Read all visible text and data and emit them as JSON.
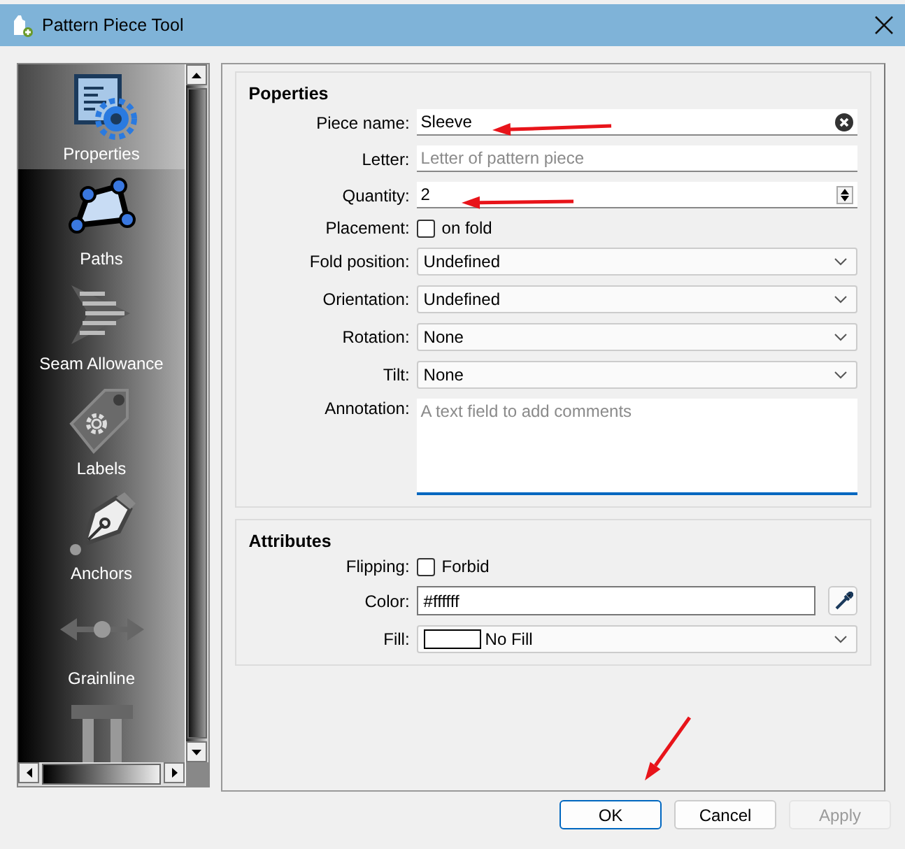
{
  "window": {
    "title": "Pattern Piece Tool"
  },
  "sidebar": {
    "items": [
      {
        "label": "Properties",
        "kind": "properties",
        "selected": true
      },
      {
        "label": "Paths",
        "kind": "paths",
        "selected": false
      },
      {
        "label": "Seam Allowance",
        "kind": "seam",
        "selected": false
      },
      {
        "label": "Labels",
        "kind": "labels",
        "selected": false
      },
      {
        "label": "Anchors",
        "kind": "anchors",
        "selected": false
      },
      {
        "label": "Grainline",
        "kind": "grainline",
        "selected": false
      },
      {
        "kind": "pillar",
        "selected": false
      }
    ]
  },
  "groups": [
    {
      "title": "Poperties",
      "fields": [
        {
          "label": "Piece name:",
          "kind": "text",
          "value": "Sleeve",
          "clearable": true
        },
        {
          "label": "Letter:",
          "kind": "text",
          "placeholder": "Letter of pattern piece"
        },
        {
          "label": "Quantity:",
          "kind": "spin",
          "value": "2"
        },
        {
          "label": "Placement:",
          "kind": "checkbox",
          "text": "on fold",
          "checked": false
        },
        {
          "label": "Fold position:",
          "kind": "combo",
          "value": "Undefined"
        },
        {
          "label": "Orientation:",
          "kind": "combo",
          "value": "Undefined"
        },
        {
          "label": "Rotation:",
          "kind": "combo",
          "value": "None"
        },
        {
          "label": "Tilt:",
          "kind": "combo",
          "value": "None"
        },
        {
          "label": "Annotation:",
          "kind": "textarea",
          "placeholder": "A text field to add comments",
          "focused": true
        }
      ]
    },
    {
      "title": "Attributes",
      "fields": [
        {
          "label": "Flipping:",
          "kind": "checkbox",
          "text": "Forbid",
          "checked": false
        },
        {
          "label": "Color:",
          "kind": "color",
          "value": "#ffffff"
        },
        {
          "label": "Fill:",
          "kind": "fill",
          "value": "No Fill"
        }
      ]
    }
  ],
  "buttons": [
    {
      "label": "OK",
      "default": true,
      "disabled": false
    },
    {
      "label": "Cancel",
      "default": false,
      "disabled": false
    },
    {
      "label": "Apply",
      "default": false,
      "disabled": true
    }
  ],
  "markup_arrows": [
    {
      "kind": "arrow"
    },
    {
      "kind": "arrow"
    },
    {
      "kind": "arrow"
    }
  ]
}
